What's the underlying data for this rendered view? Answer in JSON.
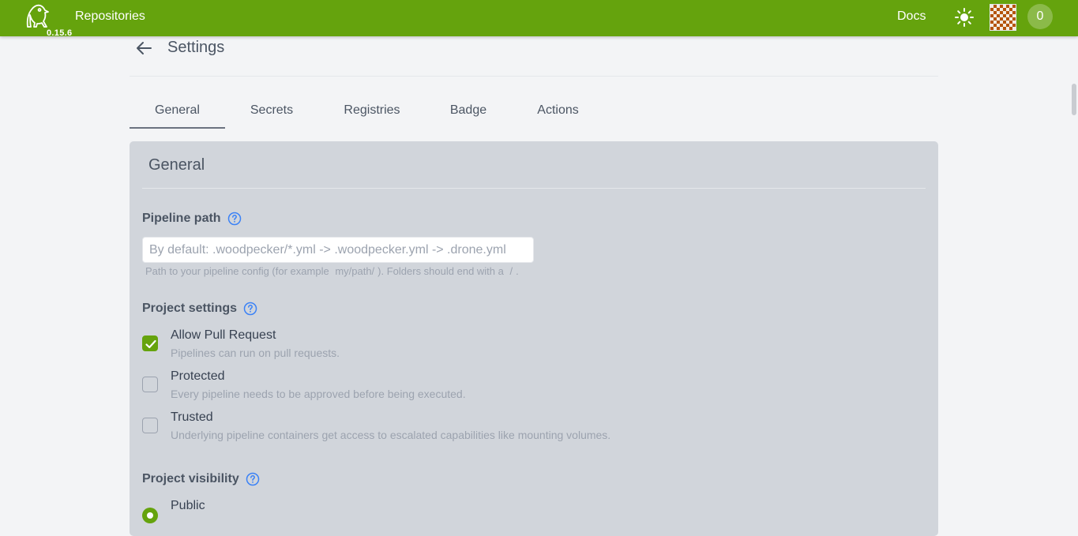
{
  "navbar": {
    "version": "0.15.6",
    "repositories_label": "Repositories",
    "docs_label": "Docs",
    "notification_count": "0"
  },
  "header": {
    "title": "Settings"
  },
  "tabs": [
    {
      "label": "General",
      "active": true
    },
    {
      "label": "Secrets",
      "active": false
    },
    {
      "label": "Registries",
      "active": false
    },
    {
      "label": "Badge",
      "active": false
    },
    {
      "label": "Actions",
      "active": false
    }
  ],
  "panel": {
    "title": "General",
    "pipeline_path": {
      "label": "Pipeline path",
      "placeholder": "By default: .woodpecker/*.yml -> .woodpecker.yml -> .drone.yml",
      "value": "",
      "hint_prefix": "Path to your pipeline config (for example",
      "hint_example": "my/path/",
      "hint_middle": "). Folders should end with a",
      "hint_slash": "/",
      "hint_suffix": "."
    },
    "project_settings": {
      "label": "Project settings",
      "options": [
        {
          "label": "Allow Pull Request",
          "description": "Pipelines can run on pull requests.",
          "checked": true
        },
        {
          "label": "Protected",
          "description": "Every pipeline needs to be approved before being executed.",
          "checked": false
        },
        {
          "label": "Trusted",
          "description": "Underlying pipeline containers get access to escalated capabilities like mounting volumes.",
          "checked": false
        }
      ]
    },
    "project_visibility": {
      "label": "Project visibility",
      "options": [
        {
          "label": "Public",
          "selected": true
        }
      ]
    }
  },
  "colors": {
    "brand": "#65a30d",
    "panel": "#d1d5db",
    "background": "#f3f4f6"
  }
}
